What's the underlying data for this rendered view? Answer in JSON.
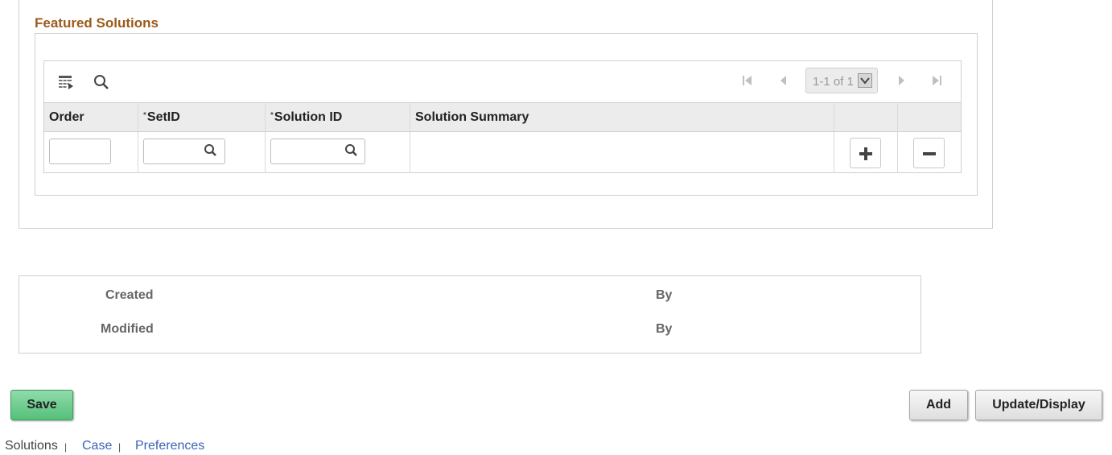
{
  "section": {
    "title": "Featured Solutions"
  },
  "grid": {
    "pagination": "1-1 of 1",
    "columns": {
      "order": "Order",
      "setid": "SetID",
      "solution_id": "Solution ID",
      "solution_summary": "Solution Summary"
    },
    "required_marker": "*",
    "rows": [
      {
        "order": "",
        "setid": "",
        "solution_id": "",
        "solution_summary": ""
      }
    ]
  },
  "audit": {
    "created_label": "Created",
    "created_by_label": "By",
    "modified_label": "Modified",
    "modified_by_label": "By"
  },
  "buttons": {
    "save": "Save",
    "add": "Add",
    "update_display": "Update/Display"
  },
  "footer": {
    "current": "Solutions",
    "separator": "|",
    "links": [
      "Case",
      "Preferences"
    ]
  },
  "colors": {
    "section_title": "#9b5a1a",
    "link": "#3a63b8",
    "save_button": "#55c07a"
  }
}
